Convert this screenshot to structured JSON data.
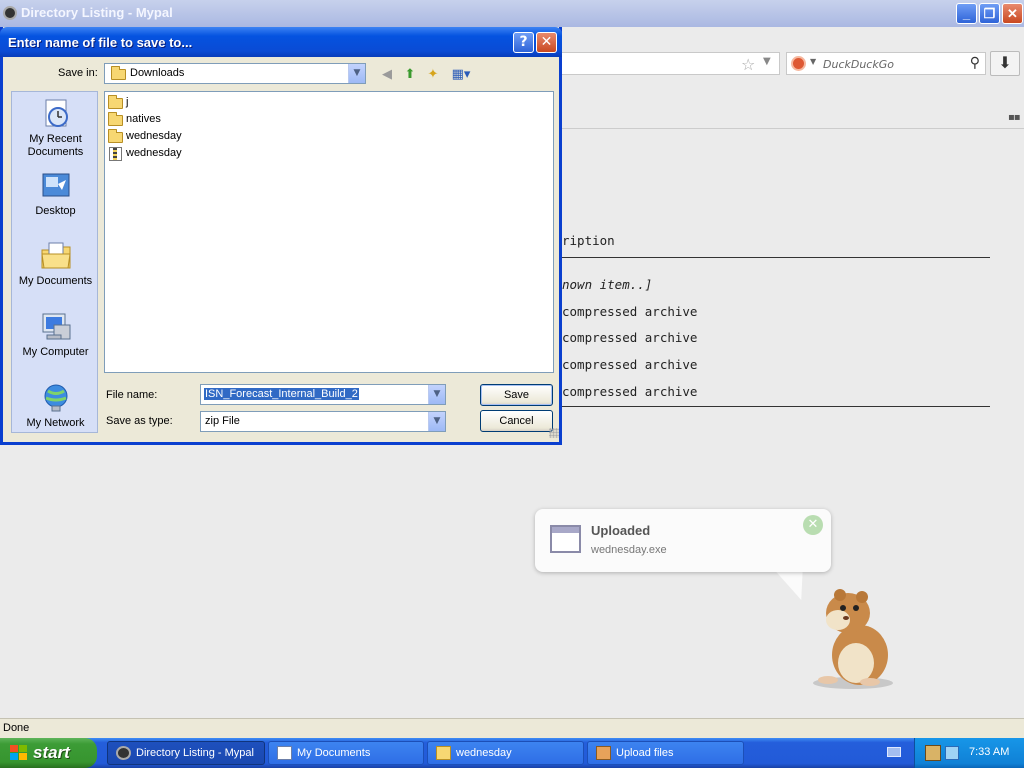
{
  "browser": {
    "title": "Directory Listing - Mypal",
    "search_placeholder": "DuckDuckGo",
    "status": "Done"
  },
  "listing": {
    "header_fragment": "ription",
    "rows": [
      {
        "text": "nown item..]",
        "italic": true
      },
      {
        "text": "compressed archive",
        "italic": false
      },
      {
        "text": "compressed archive",
        "italic": false
      },
      {
        "text": "compressed archive",
        "italic": false
      },
      {
        "text": "compressed archive",
        "italic": false
      }
    ]
  },
  "dialog": {
    "title": "Enter name of file to save to...",
    "save_in_label": "Save in:",
    "save_in_value": "Downloads",
    "places": [
      "My Recent Documents",
      "Desktop",
      "My Documents",
      "My Computer",
      "My Network"
    ],
    "files": [
      {
        "name": "j",
        "type": "folder"
      },
      {
        "name": "natives",
        "type": "folder"
      },
      {
        "name": "wednesday",
        "type": "folder"
      },
      {
        "name": "wednesday",
        "type": "zip"
      }
    ],
    "file_name_label": "File name:",
    "file_name_value": "ISN_Forecast_Internal_Build_2",
    "save_as_label": "Save as type:",
    "save_as_value": "zip File",
    "save_button": "Save",
    "cancel_button": "Cancel"
  },
  "notification": {
    "title": "Uploaded",
    "subtitle": "wednesday.exe"
  },
  "taskbar": {
    "start": "start",
    "tasks": [
      {
        "label": "Directory Listing - Mypal",
        "active": true
      },
      {
        "label": "My Documents",
        "active": false
      },
      {
        "label": "wednesday",
        "active": false
      },
      {
        "label": "Upload files",
        "active": false
      }
    ],
    "clock": "7:33 AM"
  },
  "colors": {
    "xp_title_blue": "#0553e0",
    "taskbar_blue": "#245edb",
    "start_green": "#3c9c36",
    "selection_blue": "#316ac5"
  }
}
